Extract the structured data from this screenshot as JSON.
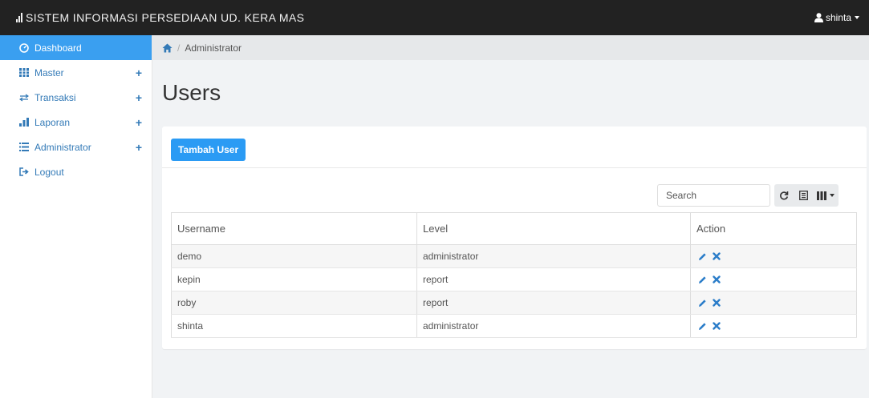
{
  "app": {
    "title": "SISTEM INFORMASI PERSEDIAAN UD. KERA MAS",
    "brand_icon": "bar-chart-icon",
    "username": "shinta"
  },
  "sidebar": {
    "items": [
      {
        "label": "Dashboard",
        "icon": "dashboard-icon",
        "active": true,
        "expandable": false
      },
      {
        "label": "Master",
        "icon": "grid-icon",
        "active": false,
        "expandable": true
      },
      {
        "label": "Transaksi",
        "icon": "transfer-icon",
        "active": false,
        "expandable": true
      },
      {
        "label": "Laporan",
        "icon": "bar-chart-icon",
        "active": false,
        "expandable": true
      },
      {
        "label": "Administrator",
        "icon": "list-icon",
        "active": false,
        "expandable": true
      },
      {
        "label": "Logout",
        "icon": "logout-icon",
        "active": false,
        "expandable": false
      }
    ],
    "expand_symbol": "+"
  },
  "breadcrumb": {
    "home_icon": "home-icon",
    "separator": "/",
    "current": "Administrator"
  },
  "page": {
    "title": "Users",
    "add_button": "Tambah User"
  },
  "toolbar": {
    "search_placeholder": "Search",
    "buttons": [
      "refresh-icon",
      "toggle-view-icon",
      "columns-icon"
    ]
  },
  "table": {
    "columns": [
      "Username",
      "Level",
      "Action"
    ],
    "rows": [
      {
        "username": "demo",
        "level": "administrator"
      },
      {
        "username": "kepin",
        "level": "report"
      },
      {
        "username": "roby",
        "level": "report"
      },
      {
        "username": "shinta",
        "level": "administrator"
      }
    ],
    "actions": [
      "edit-icon",
      "delete-icon"
    ]
  },
  "colors": {
    "navbar": "#222222",
    "accent": "#3a9ff0",
    "link": "#337ab7",
    "action": "#2b7dc9"
  }
}
